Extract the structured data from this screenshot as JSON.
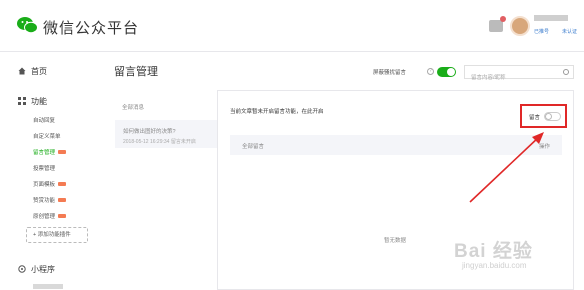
{
  "header": {
    "brand": "微信公众平台",
    "account_links": [
      "已推号",
      "未认证"
    ]
  },
  "sidebar": {
    "home": "首页",
    "function": "功能",
    "items": [
      {
        "label": "自动回复",
        "new": false
      },
      {
        "label": "自定义菜单",
        "new": false
      },
      {
        "label": "留言管理",
        "new": true,
        "active": true
      },
      {
        "label": "投票管理",
        "new": false
      },
      {
        "label": "页面模板",
        "new": true
      },
      {
        "label": "赞赏功能",
        "new": true
      },
      {
        "label": "原创管理",
        "new": true
      }
    ],
    "add_plugin": "+ 添加功能插件",
    "miniprogram": "小程序"
  },
  "main": {
    "title": "留言管理",
    "toggle_label": "屏蔽骚扰留言",
    "toggle_on": true,
    "search_placeholder": "留言内容/昵称",
    "all_messages": "全部消息",
    "article": {
      "title": "如何做出图好的决策?",
      "date": "2018-05-12 16:29:34",
      "status": "留言未开启"
    },
    "notice": "当前文章暂未开启留言功能，在此开启",
    "comment_label": "留言",
    "comment_toggle_on": false,
    "table_headers": {
      "all": "全部留言",
      "ops": "操作"
    },
    "empty": "暂无数据"
  },
  "watermark": {
    "main": "Bai 经验",
    "url": "jingyan.baidu.com"
  },
  "colors": {
    "accent": "#1aad19",
    "highlight": "#e02828",
    "new_badge": "#f47b53"
  }
}
